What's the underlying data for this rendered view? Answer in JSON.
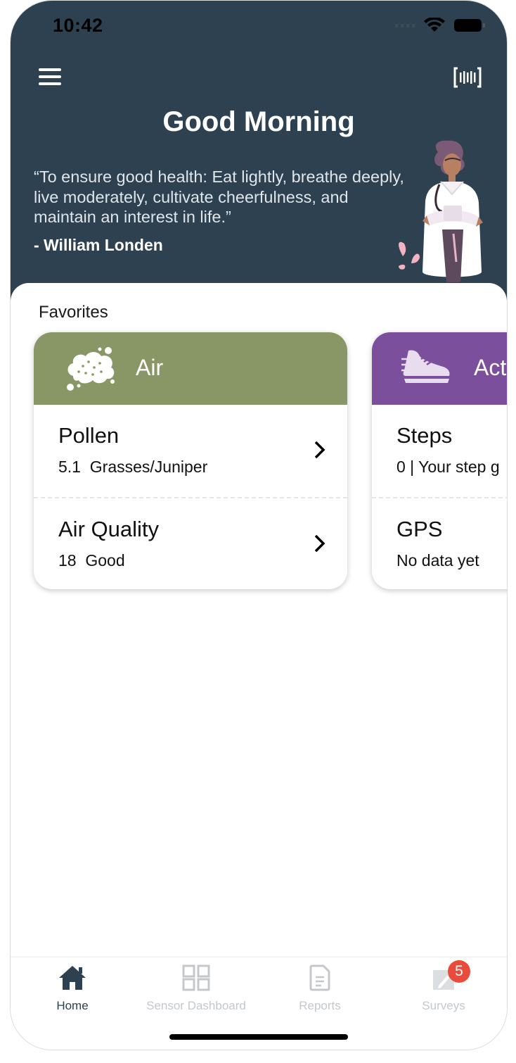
{
  "status_bar": {
    "time": "10:42"
  },
  "header": {
    "greeting": "Good Morning",
    "quote": "“To ensure good health: Eat lightly, breathe deeply, live moderately, cultivate cheerfulness, and maintain an interest in life.”",
    "author": "- William Londen"
  },
  "favorites": {
    "title": "Favorites",
    "cards": [
      {
        "category": "Air",
        "color": "#899766",
        "icon": "pollen-cloud-icon",
        "rows": [
          {
            "title": "Pollen",
            "value": "5.1",
            "detail": "Grasses/Juniper"
          },
          {
            "title": "Air Quality",
            "value": "18",
            "detail": "Good"
          }
        ]
      },
      {
        "category": "Act",
        "color": "#7b4f9c",
        "icon": "sneaker-icon",
        "rows": [
          {
            "title": "Steps",
            "value": "0 | Your step g"
          },
          {
            "title": "GPS",
            "value": "No data yet"
          }
        ]
      }
    ]
  },
  "tabs": [
    {
      "label": "Home",
      "icon": "home-icon",
      "active": true
    },
    {
      "label": "Sensor Dashboard",
      "icon": "dashboard-grid-icon",
      "active": false
    },
    {
      "label": "Reports",
      "icon": "document-icon",
      "active": false
    },
    {
      "label": "Surveys",
      "icon": "pencil-icon",
      "active": false,
      "badge": "5"
    }
  ],
  "colors": {
    "header_bg": "#2e4150",
    "active_tab": "#2e4150",
    "inactive_tab": "#c4c8cc",
    "badge": "#e94b3c"
  }
}
